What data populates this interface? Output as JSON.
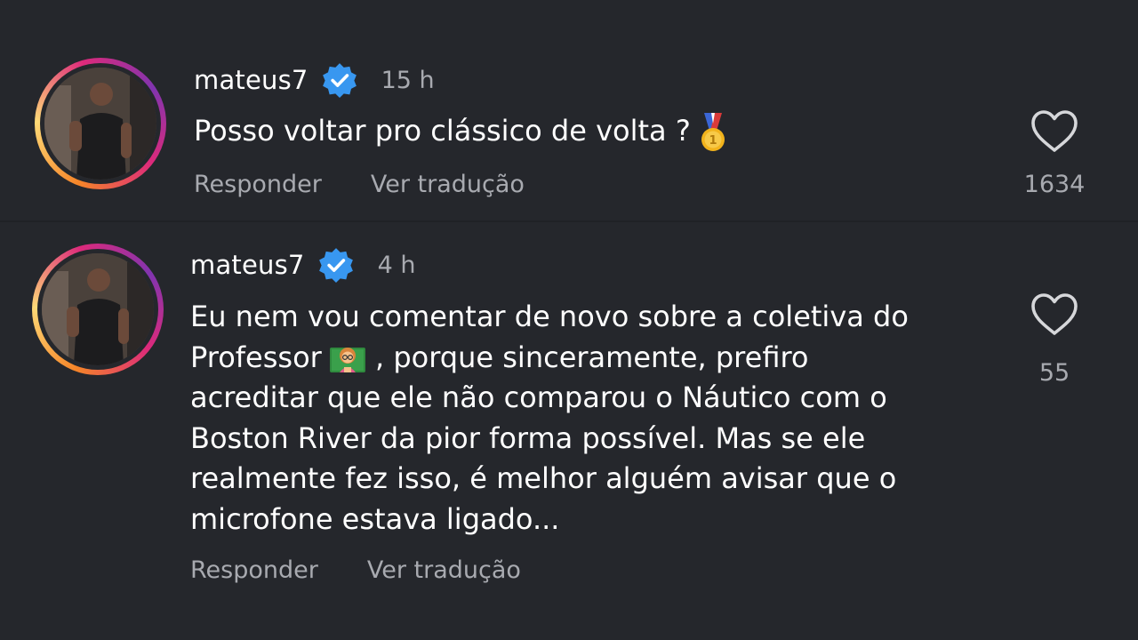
{
  "colors": {
    "background": "#25272c",
    "text_primary": "#ffffff",
    "text_secondary": "#a8aab0",
    "verified_blue": "#3897f0"
  },
  "comments": [
    {
      "username": "mateus7",
      "verified": true,
      "time": "15 h",
      "text": "Posso voltar pro clássico de volta ?",
      "emoji": "medal-icon",
      "reply_label": "Responder",
      "translate_label": "Ver tradução",
      "like_icon": "heart-outline-icon",
      "likes": "1634"
    },
    {
      "username": "mateus7",
      "verified": true,
      "time": "4 h",
      "text_before_emoji": "Eu nem vou comentar de novo sobre a coletiva do\nProfessor",
      "emoji": "teacher-icon",
      "text_after_emoji": " , porque sinceramente, prefiro\nacreditar que ele não comparou o Náutico com o\nBoston River da pior forma possível. Mas se ele\nrealmente fez isso, é melhor alguém avisar que o\nmicrofone estava ligado...",
      "reply_label": "Responder",
      "translate_label": "Ver tradução",
      "like_icon": "heart-outline-icon",
      "likes": "55"
    }
  ]
}
